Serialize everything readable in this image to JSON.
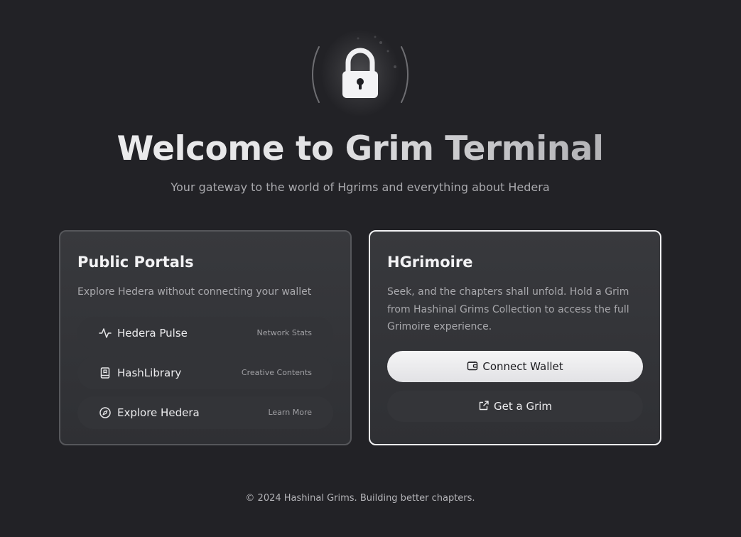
{
  "hero": {
    "title": "Welcome to Grim Terminal",
    "subtitle": "Your gateway to the world of Hgrims and everything about Hedera",
    "icon": "lock-icon"
  },
  "public_portals": {
    "title": "Public Portals",
    "description": "Explore Hedera without connecting your wallet",
    "items": [
      {
        "label": "Hedera Pulse",
        "meta": "Network Stats",
        "icon": "activity-icon"
      },
      {
        "label": "HashLibrary",
        "meta": "Creative Contents",
        "icon": "book-icon"
      },
      {
        "label": "Explore Hedera",
        "meta": "Learn More",
        "icon": "compass-icon"
      }
    ]
  },
  "hgrimoire": {
    "title": "HGrimoire",
    "description": "Seek, and the chapters shall unfold. Hold a Grim from Hashinal Grims Collection to access the full Grimoire experience.",
    "connect_label": "Connect Wallet",
    "connect_icon": "wallet-icon",
    "get_label": "Get a Grim",
    "get_icon": "external-link-icon"
  },
  "footer": {
    "text": "© 2024 Hashinal Grims. Building better chapters."
  },
  "colors": {
    "background": "#222226",
    "card": "#35363a",
    "accent_border": "#f2f2f4",
    "primary_button": "#f0f0f2"
  }
}
